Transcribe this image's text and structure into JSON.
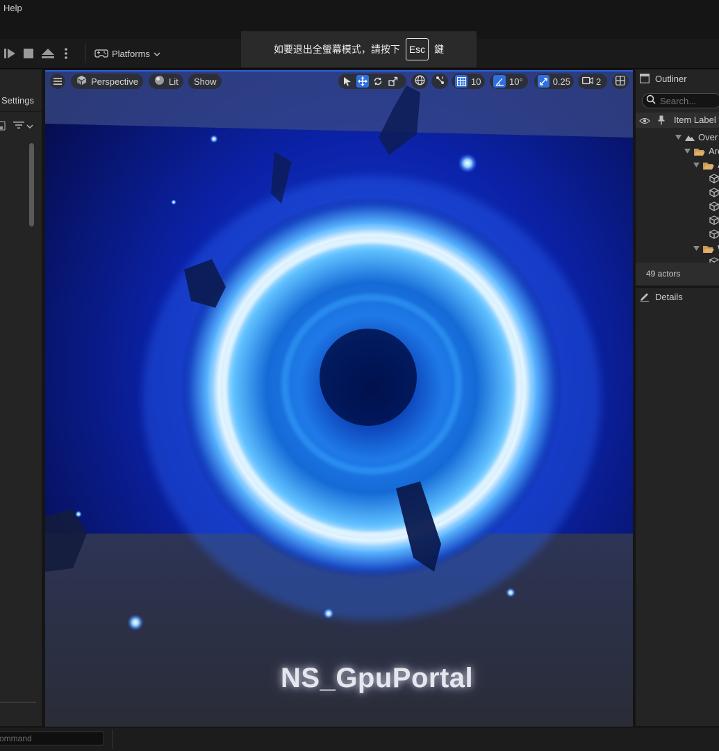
{
  "menu": {
    "help": "Help"
  },
  "toolbar": {
    "platforms_label": "Platforms"
  },
  "fullscreen_notice": {
    "before": "如要退出全螢幕模式，請按下",
    "key": "Esc",
    "after": "鍵"
  },
  "left_panel": {
    "title": "Settings"
  },
  "viewport": {
    "perspective_label": "Perspective",
    "lit_label": "Lit",
    "show_label": "Show",
    "grid_snap_value": "10",
    "rotation_snap_value": "10°",
    "scale_snap_value": "0.25",
    "camera_speed_value": "2",
    "overlay_text": "NS_GpuPortal"
  },
  "outliner": {
    "title": "Outliner",
    "search_placeholder": "Search...",
    "column_item_label": "Item Label",
    "tree_items": [
      "Over",
      "Are",
      "A",
      "W"
    ],
    "actor_count": "49 actors"
  },
  "details": {
    "title": "Details"
  },
  "bottom": {
    "command_placeholder": "ommand"
  },
  "colors": {
    "accent": "#2a62d6",
    "panel_bg": "#242424",
    "portal_core": "#3aa8ff"
  }
}
